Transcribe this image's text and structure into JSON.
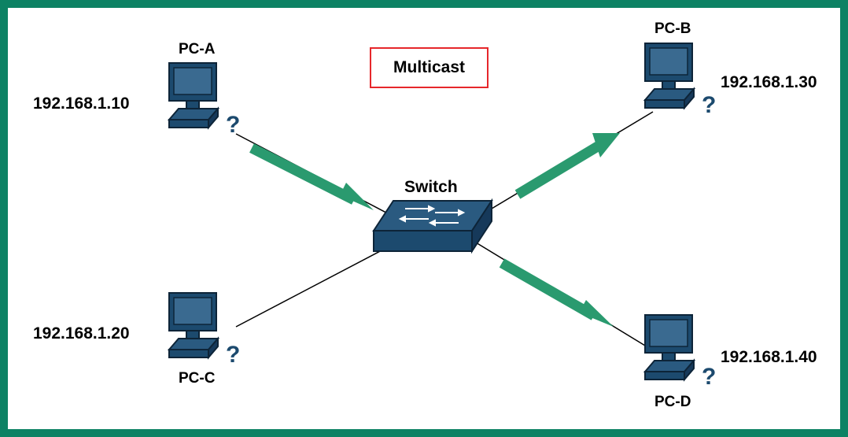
{
  "title": "Multicast",
  "switch_label": "Switch",
  "nodes": {
    "pc_a": {
      "label": "PC-A",
      "ip": "192.168.1.10"
    },
    "pc_b": {
      "label": "PC-B",
      "ip": "192.168.1.30"
    },
    "pc_c": {
      "label": "PC-C",
      "ip": "192.168.1.20"
    },
    "pc_d": {
      "label": "PC-D",
      "ip": "192.168.1.40"
    }
  },
  "colors": {
    "border": "#0d8264",
    "arrow": "#2a9a6f",
    "title_border": "#e6272b",
    "device_fill": "#1c4a6e",
    "device_stroke": "#0d2438"
  },
  "diagram_description": "Multicast network topology. PC-A sends traffic to the central Switch, which forwards it to PC-B and PC-D (multicast group members). PC-C is connected but does not receive the multicast traffic.",
  "flows": [
    {
      "from": "PC-A",
      "to": "Switch"
    },
    {
      "from": "Switch",
      "to": "PC-B"
    },
    {
      "from": "Switch",
      "to": "PC-D"
    }
  ]
}
